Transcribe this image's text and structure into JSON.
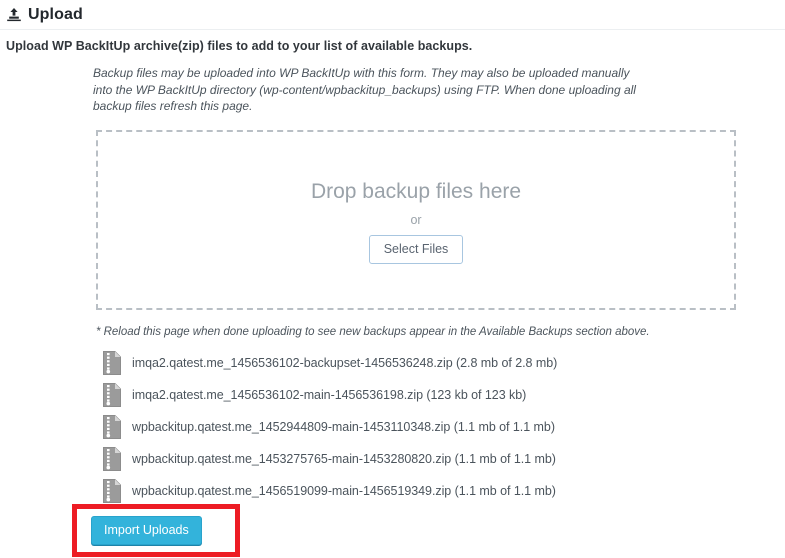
{
  "header": {
    "icon": "upload-icon",
    "title": "Upload",
    "subtitle": "Upload WP BackItUp archive(zip) files to add to your list of available backups."
  },
  "intro": {
    "note": "Backup files may be uploaded into WP BackItUp with this form. They may also be uploaded manually into the WP BackItUp directory (wp-content/wpbackitup_backups) using FTP. When done uploading all backup files refresh this page."
  },
  "dropzone": {
    "headline": "Drop backup files here",
    "or_label": "or",
    "select_files_label": "Select Files"
  },
  "reload_note": "* Reload this page when done uploading to see new backups appear in the Available Backups section above.",
  "files": [
    {
      "icon": "zip-file-icon",
      "name": "imqa2.qatest.me_1456536102-backupset-1456536248.zip (2.8 mb of 2.8 mb)",
      "progress": 100
    },
    {
      "icon": "zip-file-icon",
      "name": "imqa2.qatest.me_1456536102-main-1456536198.zip (123 kb of 123 kb)",
      "progress": 100
    },
    {
      "icon": "zip-file-icon",
      "name": "wpbackitup.qatest.me_1452944809-main-1453110348.zip (1.1 mb of 1.1 mb)",
      "progress": 100
    },
    {
      "icon": "zip-file-icon",
      "name": "wpbackitup.qatest.me_1453275765-main-1453280820.zip (1.1 mb of 1.1 mb)",
      "progress": 100
    },
    {
      "icon": "zip-file-icon",
      "name": "wpbackitup.qatest.me_1456519099-main-1456519349.zip (1.1 mb of 1.1 mb)",
      "progress": 100
    }
  ],
  "footer": {
    "import_label": "Import Uploads"
  },
  "colors": {
    "progress_green": "#048004",
    "button_blue": "#33b3db",
    "highlight_red": "#ed1c24",
    "dashed_border": "#b9bfc5"
  }
}
